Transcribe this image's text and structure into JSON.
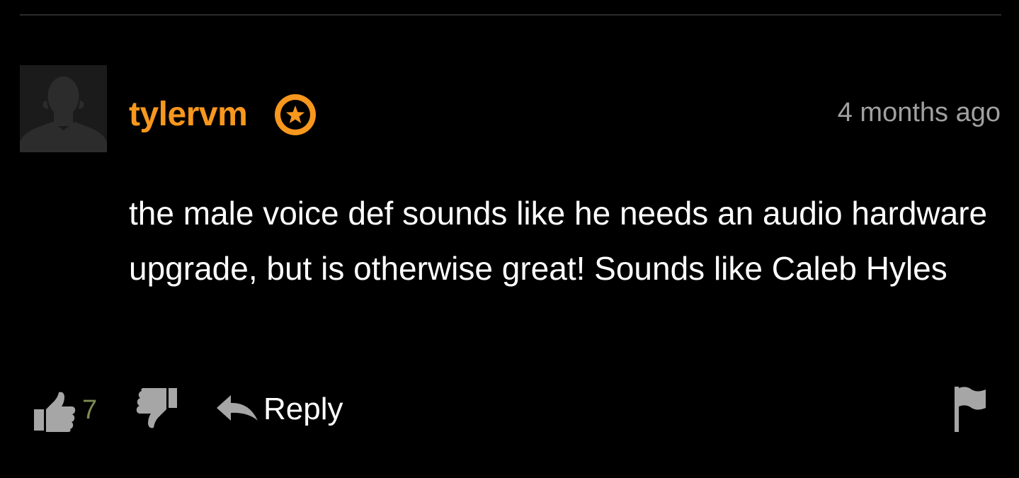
{
  "comment": {
    "username": "tylervm",
    "timestamp": "4 months ago",
    "text": "the male voice def sounds like he needs an audio hardware upgrade, but is otherwise great! Sounds like Caleb Hyles",
    "likes": "7",
    "reply_label": "Reply"
  },
  "icons": {
    "avatar": "default-avatar-silhouette",
    "badge": "star-badge-icon",
    "like": "thumbs-up-icon",
    "dislike": "thumbs-down-icon",
    "reply": "reply-arrow-icon",
    "flag": "flag-icon"
  },
  "colors": {
    "background": "#000000",
    "username": "#f7971d",
    "timestamp": "#a0a0a0",
    "text": "#ffffff",
    "icons": "#a6a6a6",
    "like_count": "#7d8a52"
  }
}
